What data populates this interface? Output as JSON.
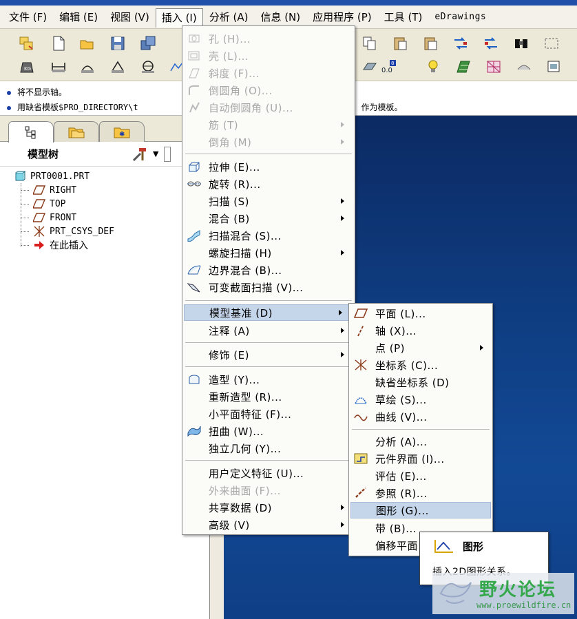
{
  "menubar": {
    "items": [
      "文件 (F)",
      "编辑 (E)",
      "视图 (V)",
      "插入 (I)",
      "分析 (A)",
      "信息 (N)",
      "应用程序 (P)",
      "工具 (T)",
      "eDrawings"
    ]
  },
  "messages": [
    "将不显示轴。",
    "用缺省模板$PRO_DIRECTORY\\t",
    "t 作为模板。"
  ],
  "left_panel": {
    "tree_title": "模型树",
    "tree_items": [
      "PRT0001.PRT",
      "RIGHT",
      "TOP",
      "FRONT",
      "PRT_CSYS_DEF",
      "在此插入"
    ]
  },
  "insert_menu": {
    "items": [
      {
        "label": "孔 (H)...",
        "icon": "hole-icon",
        "enabled": false
      },
      {
        "label": "壳 (L)...",
        "icon": "shell-icon",
        "enabled": false
      },
      {
        "label": "斜度 (F)...",
        "icon": "draft-icon",
        "enabled": false
      },
      {
        "label": "倒圆角 (O)...",
        "icon": "round-icon",
        "enabled": false
      },
      {
        "label": "自动倒圆角 (U)...",
        "icon": "auto-round-icon",
        "enabled": false
      },
      {
        "label": "筋 (T)",
        "icon": "",
        "enabled": false,
        "submenu": true
      },
      {
        "label": "倒角 (M)",
        "icon": "",
        "enabled": false,
        "submenu": true
      },
      {
        "label": "拉伸 (E)...",
        "icon": "extrude-icon",
        "enabled": true
      },
      {
        "label": "旋转 (R)...",
        "icon": "revolve-icon",
        "enabled": true
      },
      {
        "label": "扫描 (S)",
        "icon": "",
        "enabled": true,
        "submenu": true
      },
      {
        "label": "混合 (B)",
        "icon": "",
        "enabled": true,
        "submenu": true
      },
      {
        "label": "扫描混合 (S)...",
        "icon": "swept-blend-icon",
        "enabled": true
      },
      {
        "label": "螺旋扫描 (H)",
        "icon": "",
        "enabled": true,
        "submenu": true
      },
      {
        "label": "边界混合 (B)...",
        "icon": "boundary-blend-icon",
        "enabled": true
      },
      {
        "label": "可变截面扫描 (V)...",
        "icon": "var-sweep-icon",
        "enabled": true
      },
      {
        "label": "模型基准 (D)",
        "icon": "",
        "enabled": true,
        "submenu": true,
        "highlighted": true
      },
      {
        "label": "注释 (A)",
        "icon": "",
        "enabled": true,
        "submenu": true
      },
      {
        "label": "修饰 (E)",
        "icon": "",
        "enabled": true,
        "submenu": true
      },
      {
        "label": "造型 (Y)...",
        "icon": "style-icon",
        "enabled": true
      },
      {
        "label": "重新造型 (R)...",
        "icon": "",
        "enabled": true
      },
      {
        "label": "小平面特征 (F)...",
        "icon": "",
        "enabled": true
      },
      {
        "label": "扭曲 (W)...",
        "icon": "warp-icon",
        "enabled": true
      },
      {
        "label": "独立几何 (Y)...",
        "icon": "",
        "enabled": true
      },
      {
        "label": "用户定义特征 (U)...",
        "icon": "",
        "enabled": true
      },
      {
        "label": "外来曲面 (F)...",
        "icon": "",
        "enabled": false
      },
      {
        "label": "共享数据 (D)",
        "icon": "",
        "enabled": true,
        "submenu": true
      },
      {
        "label": "高级 (V)",
        "icon": "",
        "enabled": true,
        "submenu": true
      }
    ]
  },
  "datum_submenu": {
    "items": [
      {
        "label": "平面 (L)...",
        "icon": "datum-plane-icon"
      },
      {
        "label": "轴 (X)...",
        "icon": "datum-axis-icon"
      },
      {
        "label": "点 (P)",
        "icon": "",
        "submenu": true
      },
      {
        "label": "坐标系 (C)...",
        "icon": "csys-icon"
      },
      {
        "label": "缺省坐标系 (D)",
        "icon": ""
      },
      {
        "label": "草绘 (S)...",
        "icon": "sketch-icon"
      },
      {
        "label": "曲线 (V)...",
        "icon": "curve-icon"
      },
      {
        "label": "分析 (A)...",
        "icon": ""
      },
      {
        "label": "元件界面 (I)...",
        "icon": "component-interface-icon"
      },
      {
        "label": "评估 (E)...",
        "icon": ""
      },
      {
        "label": "参照 (R)...",
        "icon": "reference-icon"
      },
      {
        "label": "图形 (G)...",
        "icon": "",
        "highlighted": true
      },
      {
        "label": "带 (B)...",
        "icon": ""
      },
      {
        "label": "偏移平面",
        "icon": ""
      }
    ]
  },
  "tooltip": {
    "title": "图形",
    "description": "插入2D图形关系。",
    "icon": "graph-icon"
  },
  "watermark": {
    "name": "野火论坛",
    "url": "www.proewildfire.cn"
  },
  "colors": {
    "accent": "#1f4fa8",
    "graphics_bg": "#0e3b7e",
    "datum_icon": "#8b3a1a",
    "watermark": "#35a84c"
  }
}
